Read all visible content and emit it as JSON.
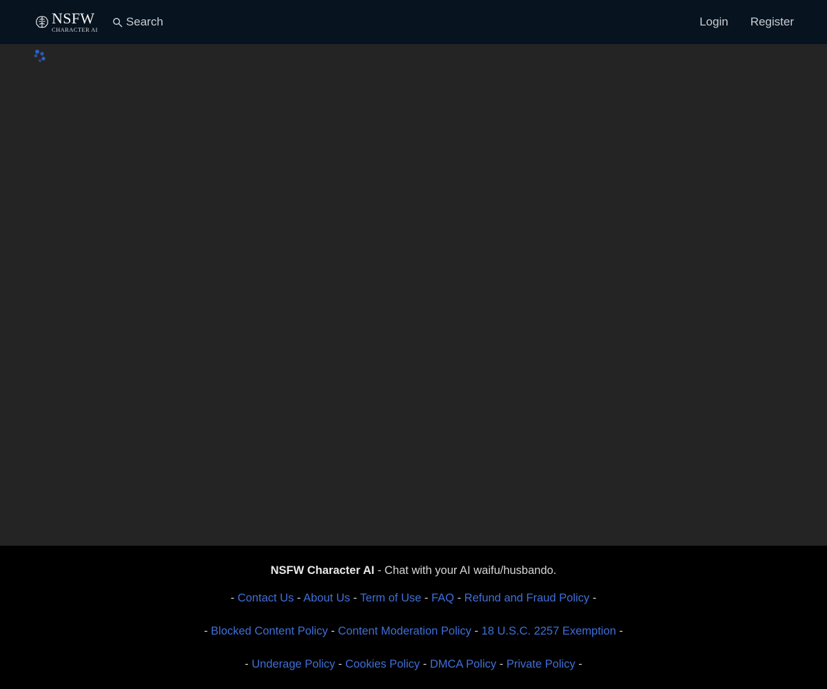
{
  "header": {
    "logo_main": "NSFW",
    "logo_sub": "CHARACTER AI",
    "search_label": "Search",
    "login_label": "Login",
    "register_label": "Register"
  },
  "footer": {
    "brand": "NSFW Character AI",
    "tagline": " - Chat with your AI waifu/husbando.",
    "link_rows": [
      [
        "Contact Us",
        "About Us",
        "Term of Use",
        "FAQ",
        "Refund and Fraud Policy"
      ],
      [
        "Blocked Content Policy",
        "Content Moderation Policy",
        "18 U.S.C. 2257 Exemption"
      ],
      [
        "Underage Policy",
        "Cookies Policy",
        "DMCA Policy",
        "Private Policy"
      ]
    ]
  },
  "colors": {
    "navbar_bg": "#07131f",
    "page_bg": "#242424",
    "footer_bg": "#000000",
    "link": "#3f6fd8",
    "spinner": "#2c5fc2"
  },
  "icons": {
    "logo": "brain-icon",
    "search": "search-icon",
    "loading": "loading-spinner-icon"
  }
}
